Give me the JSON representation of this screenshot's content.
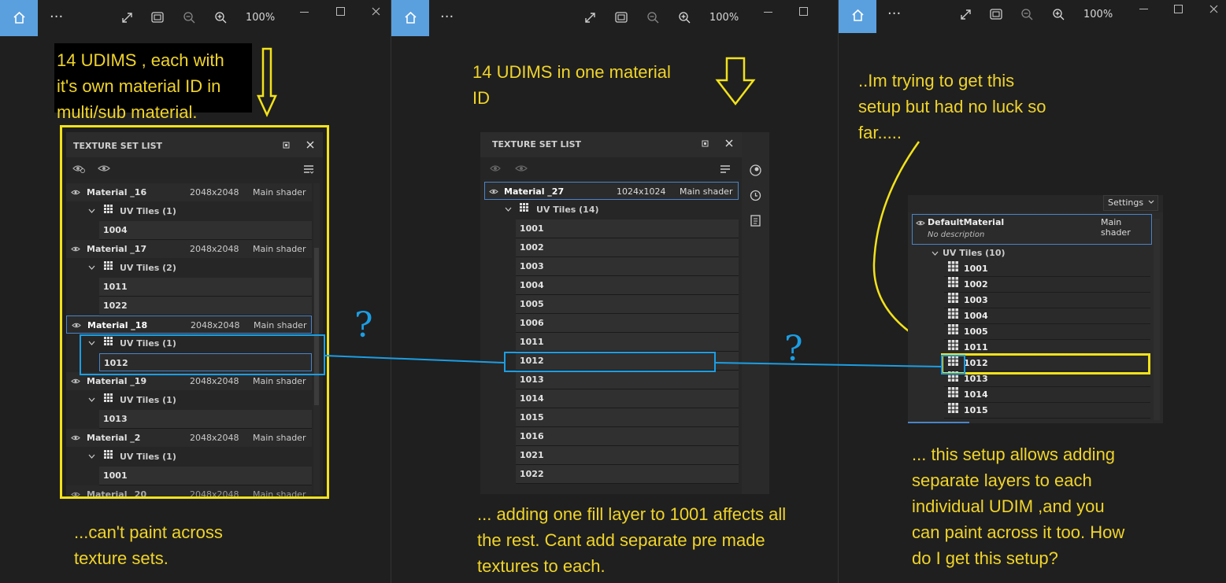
{
  "viewer": {
    "zoom": "100%",
    "more_label": "···"
  },
  "colors": {
    "annotation_yellow": "#f0d42a",
    "annotation_blue": "#1b9ee4",
    "home_accent": "#5aa0df",
    "panel_bg": "#262626"
  },
  "annotations": {
    "left_top": "14 UDIMS , each with\nit's own material ID in\nmulti/sub material.",
    "left_bottom": "...can't paint across\ntexture sets.",
    "middle_top": "14 UDIMS in one material\nID",
    "middle_bottom": "... adding one fill layer to 1001 affects all\nthe rest. Cant add separate pre made\ntextures to each.",
    "right_top": "..Im trying to get this\nsetup but had no luck so\nfar.....",
    "right_bottom": "... this setup allows adding\nseparate layers to each\nindividual UDIM ,and you\ncan paint across it too. How\ndo I get this setup?",
    "question_mark": "?"
  },
  "left_panel": {
    "title": "TEXTURE SET LIST",
    "materials": [
      {
        "name": "Material _16",
        "size": "2048x2048",
        "shader": "Main shader",
        "uv_label": "UV Tiles (1)",
        "tiles": [
          "1004"
        ]
      },
      {
        "name": "Material _17",
        "size": "2048x2048",
        "shader": "Main shader",
        "uv_label": "UV Tiles (2)",
        "tiles": [
          "1011",
          "1022"
        ]
      },
      {
        "name": "Material _18",
        "size": "2048x2048",
        "shader": "Main shader",
        "uv_label": "UV Tiles (1)",
        "tiles": [
          "1012"
        ]
      },
      {
        "name": "Material _19",
        "size": "2048x2048",
        "shader": "Main shader",
        "uv_label": "UV Tiles (1)",
        "tiles": [
          "1013"
        ]
      },
      {
        "name": "Material _2",
        "size": "2048x2048",
        "shader": "Main shader",
        "uv_label": "UV Tiles (1)",
        "tiles": [
          "1001"
        ]
      }
    ],
    "partial_row": {
      "name": "Material _20",
      "size": "2048x2048",
      "shader": "Main shader"
    }
  },
  "middle_panel": {
    "title": "TEXTURE SET LIST",
    "material": {
      "name": "Material _27",
      "size": "1024x1024",
      "shader": "Main shader"
    },
    "uv_label": "UV Tiles (14)",
    "tiles": [
      "1001",
      "1002",
      "1003",
      "1004",
      "1005",
      "1006",
      "1011",
      "1012",
      "1013",
      "1014",
      "1015",
      "1016",
      "1021",
      "1022"
    ]
  },
  "right_panel": {
    "settings_label": "Settings",
    "material": {
      "name": "DefaultMaterial",
      "shader": "Main shader",
      "description": "No description"
    },
    "uv_label": "UV Tiles (10)",
    "tiles": [
      "1001",
      "1002",
      "1003",
      "1004",
      "1005",
      "1011",
      "1012",
      "1013",
      "1014",
      "1015"
    ]
  }
}
